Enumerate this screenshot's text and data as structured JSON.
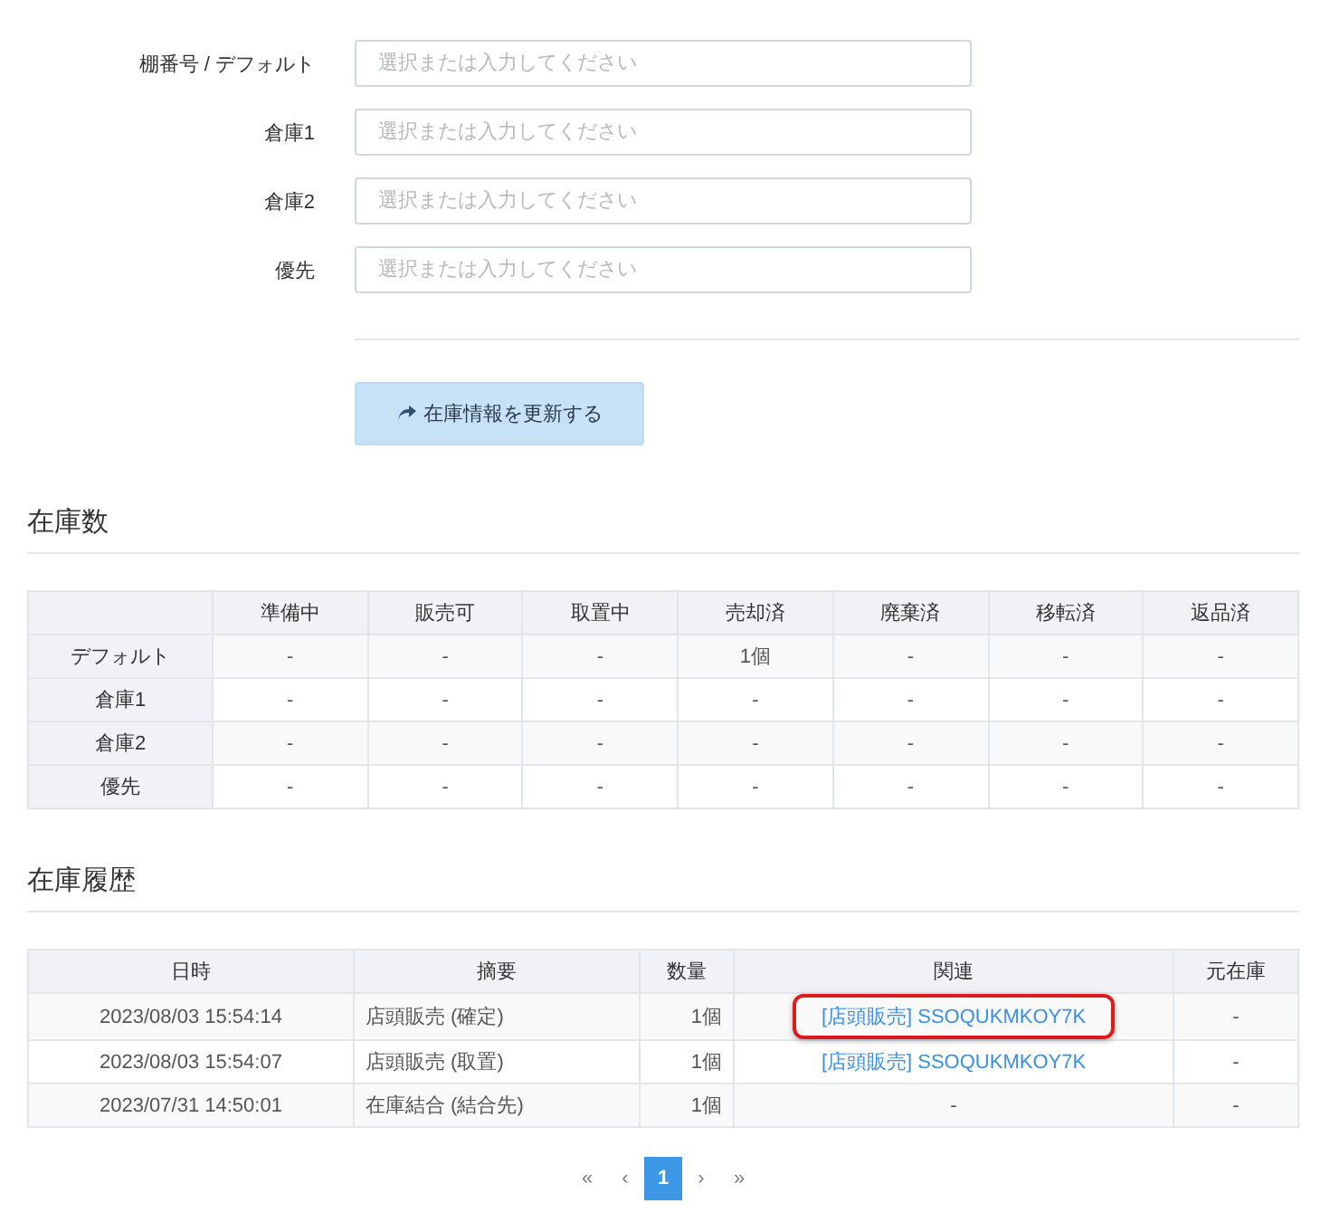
{
  "form": {
    "fields": [
      {
        "label": "棚番号 / デフォルト",
        "placeholder": "選択または入力してください"
      },
      {
        "label": "倉庫1",
        "placeholder": "選択または入力してください"
      },
      {
        "label": "倉庫2",
        "placeholder": "選択または入力してください"
      },
      {
        "label": "優先",
        "placeholder": "選択または入力してください"
      }
    ],
    "submit_button": "在庫情報を更新する"
  },
  "stock_section": {
    "title": "在庫数",
    "columns": [
      "準備中",
      "販売可",
      "取置中",
      "売却済",
      "廃棄済",
      "移転済",
      "返品済"
    ],
    "rows": [
      {
        "label": "デフォルト",
        "cells": [
          "-",
          "-",
          "-",
          "1個",
          "-",
          "-",
          "-"
        ]
      },
      {
        "label": "倉庫1",
        "cells": [
          "-",
          "-",
          "-",
          "-",
          "-",
          "-",
          "-"
        ]
      },
      {
        "label": "倉庫2",
        "cells": [
          "-",
          "-",
          "-",
          "-",
          "-",
          "-",
          "-"
        ]
      },
      {
        "label": "優先",
        "cells": [
          "-",
          "-",
          "-",
          "-",
          "-",
          "-",
          "-"
        ]
      }
    ]
  },
  "history_section": {
    "title": "在庫履歴",
    "columns": [
      "日時",
      "摘要",
      "数量",
      "関連",
      "元在庫"
    ],
    "rows": [
      {
        "datetime": "2023/08/03 15:54:14",
        "summary": "店頭販売 (確定)",
        "quantity": "1個",
        "related": {
          "kind": "link",
          "text": "[店頭販売] SSOQUKMKOY7K",
          "highlighted": true
        },
        "source": "-"
      },
      {
        "datetime": "2023/08/03 15:54:07",
        "summary": "店頭販売 (取置)",
        "quantity": "1個",
        "related": {
          "kind": "link",
          "text": "[店頭販売] SSOQUKMKOY7K",
          "highlighted": false
        },
        "source": "-"
      },
      {
        "datetime": "2023/07/31 14:50:01",
        "summary": "在庫結合 (結合先)",
        "quantity": "1個",
        "related": {
          "kind": "text",
          "text": "-",
          "highlighted": false
        },
        "source": "-"
      }
    ]
  },
  "pagination": {
    "items": [
      {
        "label": "«",
        "selected": false
      },
      {
        "label": "‹",
        "selected": false
      },
      {
        "label": "1",
        "selected": true
      },
      {
        "label": "›",
        "selected": false
      },
      {
        "label": "»",
        "selected": false
      }
    ]
  }
}
